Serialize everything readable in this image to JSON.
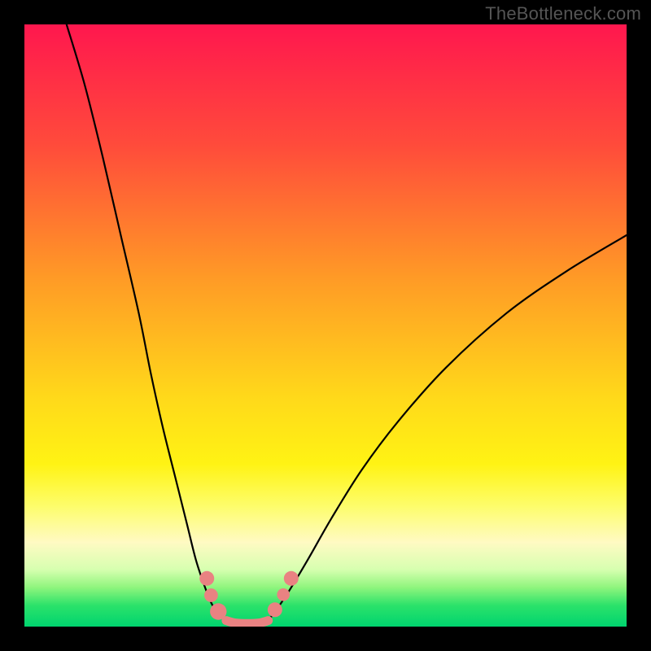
{
  "watermark": "TheBottleneck.com",
  "chart_data": {
    "type": "line",
    "title": "",
    "xlabel": "",
    "ylabel": "",
    "xlim": [
      0,
      100
    ],
    "ylim": [
      0,
      100
    ],
    "grid": false,
    "background_gradient": [
      {
        "pos": 0.0,
        "color": "#ff174e"
      },
      {
        "pos": 0.2,
        "color": "#ff4b3b"
      },
      {
        "pos": 0.42,
        "color": "#ff9a26"
      },
      {
        "pos": 0.62,
        "color": "#ffd91a"
      },
      {
        "pos": 0.73,
        "color": "#fff314"
      },
      {
        "pos": 0.8,
        "color": "#fdfd6b"
      },
      {
        "pos": 0.86,
        "color": "#fffac3"
      },
      {
        "pos": 0.905,
        "color": "#d7ffb0"
      },
      {
        "pos": 0.935,
        "color": "#8ff57d"
      },
      {
        "pos": 0.965,
        "color": "#2be26a"
      },
      {
        "pos": 1.0,
        "color": "#00d46f"
      }
    ],
    "series": [
      {
        "name": "curve-left",
        "stroke": "#000000",
        "x": [
          7,
          10,
          13,
          16,
          19,
          21,
          23,
          25,
          27,
          28.5,
          30,
          31,
          32,
          33.5
        ],
        "y": [
          100,
          90,
          78,
          65,
          52,
          42,
          33,
          25,
          17,
          11,
          6.5,
          4,
          2.3,
          1
        ]
      },
      {
        "name": "curve-right",
        "stroke": "#000000",
        "x": [
          40.5,
          42,
          44,
          47,
          51,
          56,
          62,
          70,
          80,
          90,
          100
        ],
        "y": [
          1,
          3,
          6,
          11,
          18,
          26,
          34,
          43,
          52,
          59,
          65
        ]
      },
      {
        "name": "floor",
        "stroke": "#e98282",
        "x": [
          33.5,
          35,
          37,
          39,
          40.5
        ],
        "y": [
          1,
          0.6,
          0.5,
          0.6,
          1
        ]
      }
    ],
    "markers": [
      {
        "name": "left-marker-1",
        "x": 30.3,
        "y": 8.0,
        "r": 1.5,
        "color": "#e98282"
      },
      {
        "name": "left-marker-2",
        "x": 31.0,
        "y": 5.2,
        "r": 1.4,
        "color": "#e98282"
      },
      {
        "name": "left-marker-3",
        "x": 32.2,
        "y": 2.5,
        "r": 1.7,
        "color": "#e98282"
      },
      {
        "name": "right-marker-1",
        "x": 41.6,
        "y": 2.8,
        "r": 1.5,
        "color": "#e98282"
      },
      {
        "name": "right-marker-2",
        "x": 43.0,
        "y": 5.3,
        "r": 1.3,
        "color": "#e98282"
      },
      {
        "name": "right-marker-3",
        "x": 44.3,
        "y": 8.0,
        "r": 1.5,
        "color": "#e98282"
      }
    ]
  }
}
